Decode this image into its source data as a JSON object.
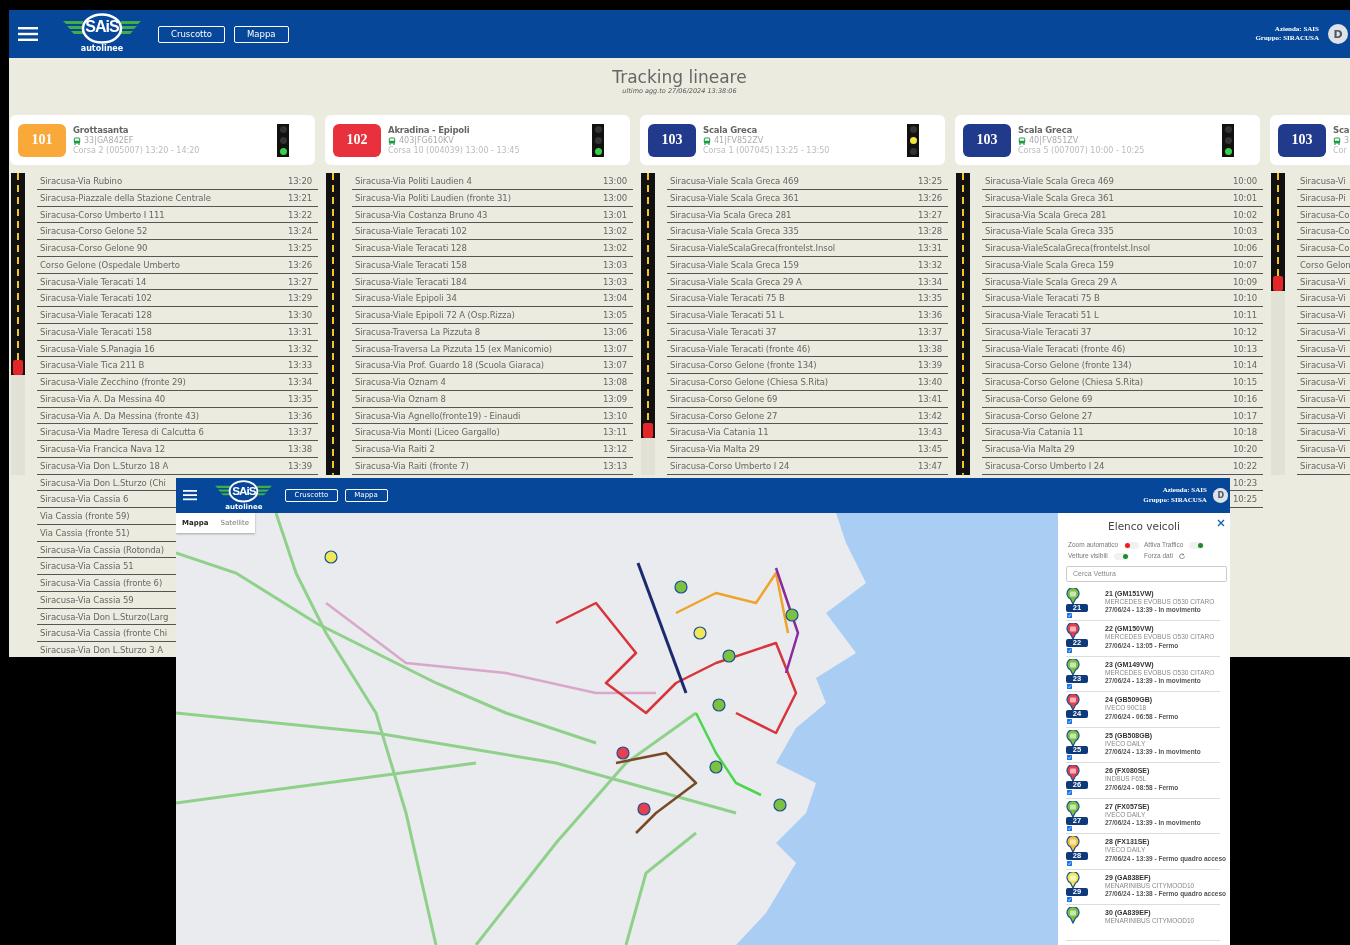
{
  "dashboard": {
    "header": {
      "logo": {
        "mark": "SAiS",
        "caption": "autolinee"
      },
      "nav": [
        {
          "label": "Cruscotto"
        },
        {
          "label": "Mappa"
        }
      ],
      "company": "Azienda: SAIS",
      "group": "Gruppo: SIRACUSA",
      "avatar": "D"
    },
    "title": "Tracking lineare",
    "updated": "ultimo agg.to 27/06/2024 13:38:06",
    "lines": [
      {
        "number": "101",
        "color": "#f9a83a",
        "name": "Grottasanta",
        "vehicle": "33|GA842EF",
        "trip": "Corsa 2 (005007) 13:20 - 14:20",
        "traffic_light": [
          {
            "on": false
          },
          {
            "on": false
          },
          {
            "on": true
          }
        ],
        "progress": {
          "level": 0.67
        },
        "stops": [
          {
            "name": "Siracusa-Via Rubino",
            "time": "13:20"
          },
          {
            "name": "Siracusa-Piazzale della Stazione Centrale",
            "time": "13:21"
          },
          {
            "name": "Siracusa-Corso Umberto I 111",
            "time": "13:22"
          },
          {
            "name": "Siracusa-Corso Gelone 52",
            "time": "13:24"
          },
          {
            "name": "Siracusa-Corso Gelone 90",
            "time": "13:25"
          },
          {
            "name": "Corso Gelone (Ospedale Umberto",
            "time": "13:26"
          },
          {
            "name": "Siracusa-Viale Teracati 14",
            "time": "13:27"
          },
          {
            "name": "Siracusa-Viale Teracati 102",
            "time": "13:29"
          },
          {
            "name": "Siracusa-Viale Teracati 128",
            "time": "13:30"
          },
          {
            "name": "Siracusa-Viale Teracati 158",
            "time": "13:31"
          },
          {
            "name": "Siracusa-Viale S.Panagia 16",
            "time": "13:32"
          },
          {
            "name": "Siracusa-Viale Tica 211 B",
            "time": "13:33"
          },
          {
            "name": "Siracusa-Viale Zecchino (fronte 29)",
            "time": "13:34"
          },
          {
            "name": "Siracusa-Via A. Da Messina 40",
            "time": "13:35"
          },
          {
            "name": "Siracusa-Via A. Da Messina (fronte 43)",
            "time": "13:36"
          },
          {
            "name": "Siracusa-Via Madre Teresa di Calcutta 6",
            "time": "13:37"
          },
          {
            "name": "Siracusa-Via Francica Nava 12",
            "time": "13:38"
          },
          {
            "name": "Siracusa-Via Don L.Sturzo 18 A",
            "time": "13:39"
          },
          {
            "name": "Siracusa-Via Don L.Sturzo (Chi"
          },
          {
            "name": "Siracusa-Via Cassia 6"
          },
          {
            "name": "Via Cassia (fronte 59)"
          },
          {
            "name": "Via Cassia (fronte 51)"
          },
          {
            "name": "Siracusa-Via Cassia (Rotonda)"
          },
          {
            "name": "Siracusa-Via Cassia 51"
          },
          {
            "name": "Siracusa-Via Cassia (fronte 6)"
          },
          {
            "name": "Siracusa-Via Cassia 59"
          },
          {
            "name": "Siracusa-Via Don L.Sturzo(Larg"
          },
          {
            "name": "Siracusa-Via Cassia (fronte Chi"
          },
          {
            "name": "Siracusa-Via Don L.Sturzo 3 A"
          }
        ]
      },
      {
        "number": "102",
        "color": "#e8313d",
        "name": "Akradina - Epipoli",
        "vehicle": "403|FG610KV",
        "trip": "Corsa 10 (004039) 13:00 - 13:45",
        "traffic_light": [
          {
            "on": false
          },
          {
            "on": false
          },
          {
            "on": true
          }
        ],
        "stops": [
          {
            "name": "Siracusa-Via Politi Laudien 4",
            "time": "13:00"
          },
          {
            "name": "Siracusa-Via Politi Laudien (fronte 31)",
            "time": "13:00"
          },
          {
            "name": "Siracusa-Via Costanza Bruno 43",
            "time": "13:01"
          },
          {
            "name": "Siracusa-Viale Teracati 102",
            "time": "13:02"
          },
          {
            "name": "Siracusa-Viale Teracati 128",
            "time": "13:02"
          },
          {
            "name": "Siracusa-Viale Teracati 158",
            "time": "13:03"
          },
          {
            "name": "Siracusa-Viale Teracati 184",
            "time": "13:03"
          },
          {
            "name": "Siracusa-Viale Epipoli 34",
            "time": "13:04"
          },
          {
            "name": "Siracusa-Viale Epipoli 72 A (Osp.Rizza)",
            "time": "13:05"
          },
          {
            "name": "Siracusa-Traversa La Pizzuta 8",
            "time": "13:06"
          },
          {
            "name": "Siracusa-Traversa La Pizzuta 15 (ex Manicomio)",
            "time": "13:07"
          },
          {
            "name": "Siracusa-Via Prof. Guardo 18 (Scuola Giaraca)",
            "time": "13:07"
          },
          {
            "name": "Siracusa-Via Oznam 4",
            "time": "13:08"
          },
          {
            "name": "Siracusa-Via Oznam 8",
            "time": "13:09"
          },
          {
            "name": "Siracusa-Via Agnello(fronte19) - Einaudi",
            "time": "13:10"
          },
          {
            "name": "Siracusa-Via Monti (Liceo Gargallo)",
            "time": "13:11"
          },
          {
            "name": "Siracusa-Via Raiti 2",
            "time": "13:12"
          },
          {
            "name": "Siracusa-Via Raiti (fronte 7)",
            "time": "13:13"
          }
        ]
      },
      {
        "number": "103",
        "color": "#213a8c",
        "name": "Scala Greca",
        "vehicle": "41|FV852ZV",
        "trip": "Corsa 1 (007045) 13:25 - 13:50",
        "traffic_light": [
          {
            "on": false
          },
          {
            "on": true
          },
          {
            "on": false
          }
        ],
        "progress": {
          "level": 0.88
        },
        "stops": [
          {
            "name": "Siracusa-Viale Scala Greca 469",
            "time": "13:25"
          },
          {
            "name": "Siracusa-Viale Scala Greca 361",
            "time": "13:26"
          },
          {
            "name": "Siracusa-Via Scala Greca 281",
            "time": "13:27"
          },
          {
            "name": "Siracusa-Viale Scala Greca 335",
            "time": "13:28"
          },
          {
            "name": "Siracusa-VialeScalaGreca(fronteIst.Insol",
            "time": "13:31"
          },
          {
            "name": "Siracusa-Viale Scala Greca 159",
            "time": "13:32"
          },
          {
            "name": "Siracusa-Viale Scala Greca 29 A",
            "time": "13:34"
          },
          {
            "name": "Siracusa-Viale Teracati 75 B",
            "time": "13:35"
          },
          {
            "name": "Siracusa-Viale Teracati 51 L",
            "time": "13:36"
          },
          {
            "name": "Siracusa-Viale Teracati 37",
            "time": "13:37"
          },
          {
            "name": "Siracusa-Viale Teracati (fronte 46)",
            "time": "13:38"
          },
          {
            "name": "Siracusa-Corso Gelone (fronte 134)",
            "time": "13:39"
          },
          {
            "name": "Siracusa-Corso Gelone (Chiesa S.Rita)",
            "time": "13:40"
          },
          {
            "name": "Siracusa-Corso Gelone 69",
            "time": "13:41"
          },
          {
            "name": "Siracusa-Corso Gelone 27",
            "time": "13:42"
          },
          {
            "name": "Siracusa-Via Catania 11",
            "time": "13:43"
          },
          {
            "name": "Siracusa-Via Malta 29",
            "time": "13:45"
          },
          {
            "name": "Siracusa-Corso Umberto I 24",
            "time": "13:47"
          }
        ]
      },
      {
        "number": "103",
        "color": "#213a8c",
        "name": "Scala Greca",
        "vehicle": "40|FV851ZV",
        "trip": "Corsa 5 (007007) 10:00 - 10:25",
        "traffic_light": [
          {
            "on": false
          },
          {
            "on": false
          },
          {
            "on": true
          }
        ],
        "stops": [
          {
            "name": "Siracusa-Viale Scala Greca 469",
            "time": "10:00"
          },
          {
            "name": "Siracusa-Viale Scala Greca 361",
            "time": "10:01"
          },
          {
            "name": "Siracusa-Via Scala Greca 281",
            "time": "10:02"
          },
          {
            "name": "Siracusa-Viale Scala Greca 335",
            "time": "10:03"
          },
          {
            "name": "Siracusa-VialeScalaGreca(fronteIst.Insol",
            "time": "10:06"
          },
          {
            "name": "Siracusa-Viale Scala Greca 159",
            "time": "10:07"
          },
          {
            "name": "Siracusa-Viale Scala Greca 29 A",
            "time": "10:09"
          },
          {
            "name": "Siracusa-Viale Teracati 75 B",
            "time": "10:10"
          },
          {
            "name": "Siracusa-Viale Teracati 51 L",
            "time": "10:11"
          },
          {
            "name": "Siracusa-Viale Teracati 37",
            "time": "10:12"
          },
          {
            "name": "Siracusa-Viale Teracati (fronte 46)",
            "time": "10:13"
          },
          {
            "name": "Siracusa-Corso Gelone (fronte 134)",
            "time": "10:14"
          },
          {
            "name": "Siracusa-Corso Gelone (Chiesa S.Rita)",
            "time": "10:15"
          },
          {
            "name": "Siracusa-Corso Gelone 69",
            "time": "10:16"
          },
          {
            "name": "Siracusa-Corso Gelone 27",
            "time": "10:17"
          },
          {
            "name": "Siracusa-Via Catania 11",
            "time": "10:18"
          },
          {
            "name": "Siracusa-Via Malta 29",
            "time": "10:20"
          },
          {
            "name": "Siracusa-Corso Umberto I 24",
            "time": "10:22"
          },
          {
            "time": "10:23"
          },
          {
            "time": "10:25"
          }
        ]
      },
      {
        "number": "103",
        "color": "#213a8c",
        "name": "Sca",
        "vehicle": "3",
        "trip": "Cor",
        "progress": {
          "level": 0.39
        },
        "stops": [
          {
            "name": "Siracusa-Vi"
          },
          {
            "name": "Siracusa-Pi"
          },
          {
            "name": "Siracusa-Co"
          },
          {
            "name": "Siracusa-Co"
          },
          {
            "name": "Siracusa-Co"
          },
          {
            "name": "Corso Gelon"
          },
          {
            "name": "Siracusa-Vi"
          },
          {
            "name": "Siracusa-Vi"
          },
          {
            "name": "Siracusa-Vi"
          },
          {
            "name": "Siracusa-Vi"
          },
          {
            "name": "Siracusa-Vi"
          },
          {
            "name": "Siracusa-Vi"
          },
          {
            "name": "Siracusa-Vi"
          },
          {
            "name": "Siracusa-Vi"
          },
          {
            "name": "Siracusa-Vi"
          },
          {
            "name": "Siracusa-Vi"
          },
          {
            "name": "Siracusa-Vi"
          },
          {
            "name": "Siracusa-Vi"
          }
        ]
      }
    ]
  },
  "map_window": {
    "header": {
      "logo": {
        "mark": "SAiS",
        "caption": "autolinee"
      },
      "nav": [
        {
          "label": "Cruscotto"
        },
        {
          "label": "Mappa"
        }
      ],
      "company": "Azienda: SAIS",
      "group": "Gruppo: SIRACUSA",
      "avatar": "D"
    },
    "map_types": [
      {
        "label": "Mappa",
        "selected": true
      },
      {
        "label": "Satellite",
        "selected": false
      }
    ],
    "vehicle_panel": {
      "title": "Elenco veicoli",
      "options": [
        {
          "kind": "switch",
          "label": "Zoom automatico",
          "on": false
        },
        {
          "kind": "switch",
          "label": "Attiva Traffico",
          "on": true
        },
        {
          "kind": "switch",
          "label": "Vetture visibili",
          "on": true
        },
        {
          "kind": "action",
          "label": "Forza dati"
        }
      ],
      "search": {
        "placeholder": "Cerca Vettura"
      },
      "vehicles": [
        {
          "marker": "21",
          "color": "#7cc242",
          "checked": true,
          "title": "21 (GM151VW)",
          "model": "MERCEDES EVOBUS O530 CITARO",
          "status": "27/06/24 - 13:39 - In movimento"
        },
        {
          "marker": "22",
          "color": "#e5404f",
          "checked": true,
          "title": "22 (GM150VW)",
          "model": "MERCEDES EVOBUS O530 CITARO",
          "status": "27/06/24 - 13:05 - Fermo"
        },
        {
          "marker": "23",
          "color": "#7cc242",
          "checked": true,
          "title": "23 (GM149VW)",
          "model": "MERCEDES EVOBUS O530 CITARO",
          "status": "27/06/24 - 13:39 - In movimento"
        },
        {
          "marker": "24",
          "color": "#e5404f",
          "checked": true,
          "title": "24 (GB509GB)",
          "model": "IVECO 90C18",
          "status": "27/06/24 - 06:58 - Fermo"
        },
        {
          "marker": "25",
          "color": "#7cc242",
          "checked": true,
          "title": "25 (GB508GB)",
          "model": "IVECO DAILY",
          "status": "27/06/24 - 13:39 - In movimento"
        },
        {
          "marker": "26",
          "color": "#e5404f",
          "checked": true,
          "title": "26 (FX080SE)",
          "model": "INDBUS F65L",
          "status": "27/06/24 - 08:58 - Fermo"
        },
        {
          "marker": "27",
          "color": "#7cc242",
          "checked": true,
          "title": "27 (FX057SE)",
          "model": "IVECO DAILY",
          "status": "27/06/24 - 13:39 - In movimento"
        },
        {
          "marker": "28",
          "color": "#f3c13a",
          "checked": true,
          "title": "28 (FX131SE)",
          "model": "IVECO DAILY",
          "status": "27/06/24 - 13:39 - Fermo quadro acceso"
        },
        {
          "marker": "29",
          "color": "#efe95a",
          "checked": true,
          "title": "29 (GA838EF)",
          "model": "MENARINIBUS CITYMOOD10",
          "status": "27/06/24 - 13:38 - Fermo quadro acceso"
        },
        {
          "color": "#7cc242",
          "title": "30 (GA839EF)",
          "model": "MENARINIBUS CITYMOOD10"
        }
      ]
    }
  }
}
